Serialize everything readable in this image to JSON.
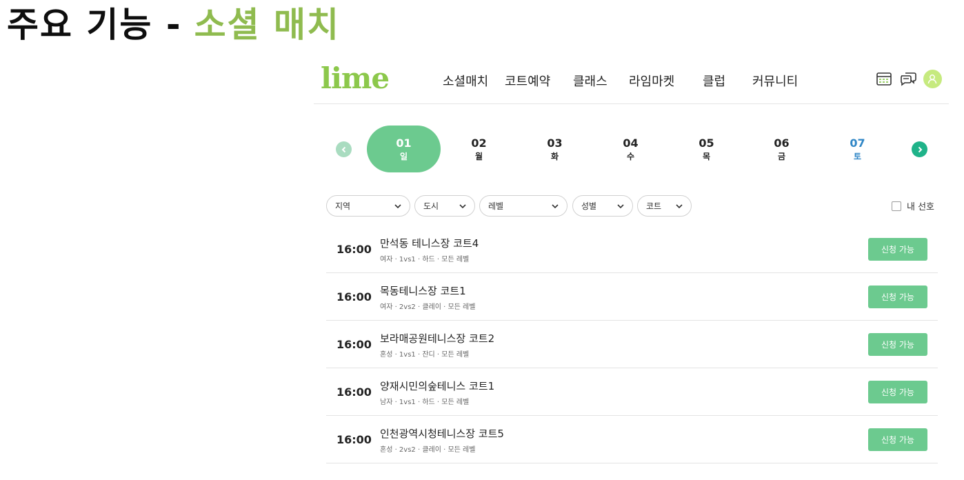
{
  "headline": {
    "prefix": "주요 기능 -",
    "highlight": "소셜 매치"
  },
  "nav": {
    "logo": "lime",
    "menu": [
      "소셜매치",
      "코트예약",
      "클래스",
      "라임마켓",
      "클럽",
      "커뮤니티"
    ],
    "icons": [
      "calendar-icon",
      "chat-icon",
      "avatar"
    ]
  },
  "dates": [
    {
      "num": "01",
      "day": "일",
      "state": "active"
    },
    {
      "num": "02",
      "day": "월",
      "state": ""
    },
    {
      "num": "03",
      "day": "화",
      "state": ""
    },
    {
      "num": "04",
      "day": "수",
      "state": ""
    },
    {
      "num": "05",
      "day": "목",
      "state": ""
    },
    {
      "num": "06",
      "day": "금",
      "state": ""
    },
    {
      "num": "07",
      "day": "토",
      "state": "sat"
    }
  ],
  "filters": [
    "지역",
    "도시",
    "레벨",
    "성별",
    "코트"
  ],
  "preference_label": "내 선호",
  "matches": [
    {
      "time": "16:00",
      "court": "만석동 테니스장 코트4",
      "meta": "여자 · 1vs1 · 하드 · 모든 레벨",
      "action": "신청 가능"
    },
    {
      "time": "16:00",
      "court": "목동테니스장 코트1",
      "meta": "여자 · 2vs2 · 클레이 · 모든 레벨",
      "action": "신청 가능"
    },
    {
      "time": "16:00",
      "court": "보라매공원테니스장 코트2",
      "meta": "혼성 · 1vs1 · 잔디 · 모든 레벨",
      "action": "신청 가능"
    },
    {
      "time": "16:00",
      "court": "양재시민의숲테니스 코트1",
      "meta": "남자 · 1vs1 · 하드 · 모든 레벨",
      "action": "신청 가능"
    },
    {
      "time": "16:00",
      "court": "인천광역시청테니스장 코트5",
      "meta": "혼성 · 2vs2 · 클레이 · 모든 레벨",
      "action": "신청 가능"
    }
  ],
  "colors": {
    "brand": "#8cc84b",
    "accent_green": "#6cca8f",
    "saturday": "#2f86c6",
    "headline_highlight": "#8fbb4f"
  }
}
